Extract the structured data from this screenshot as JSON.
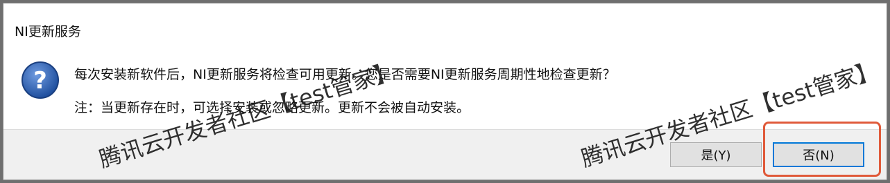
{
  "dialog": {
    "title": "NI更新服务",
    "icon": "question-icon",
    "message_line1": "每次安装新软件后，NI更新服务将检查可用更新。您是否需要NI更新服务周期性地检查更新？",
    "message_line2": "注：当更新存在时，可选择安装或忽略更新。更新不会被自动安装。",
    "yes_label": "是(Y)",
    "no_label": "否(N)"
  },
  "watermarks": {
    "left": "腾讯云开发者社区【test管家】",
    "right": "腾讯云开发者社区【test管家】"
  },
  "colors": {
    "highlight_border": "#e05a3a",
    "focus_border": "#0078d7",
    "icon_blue": "#2b5fae"
  }
}
